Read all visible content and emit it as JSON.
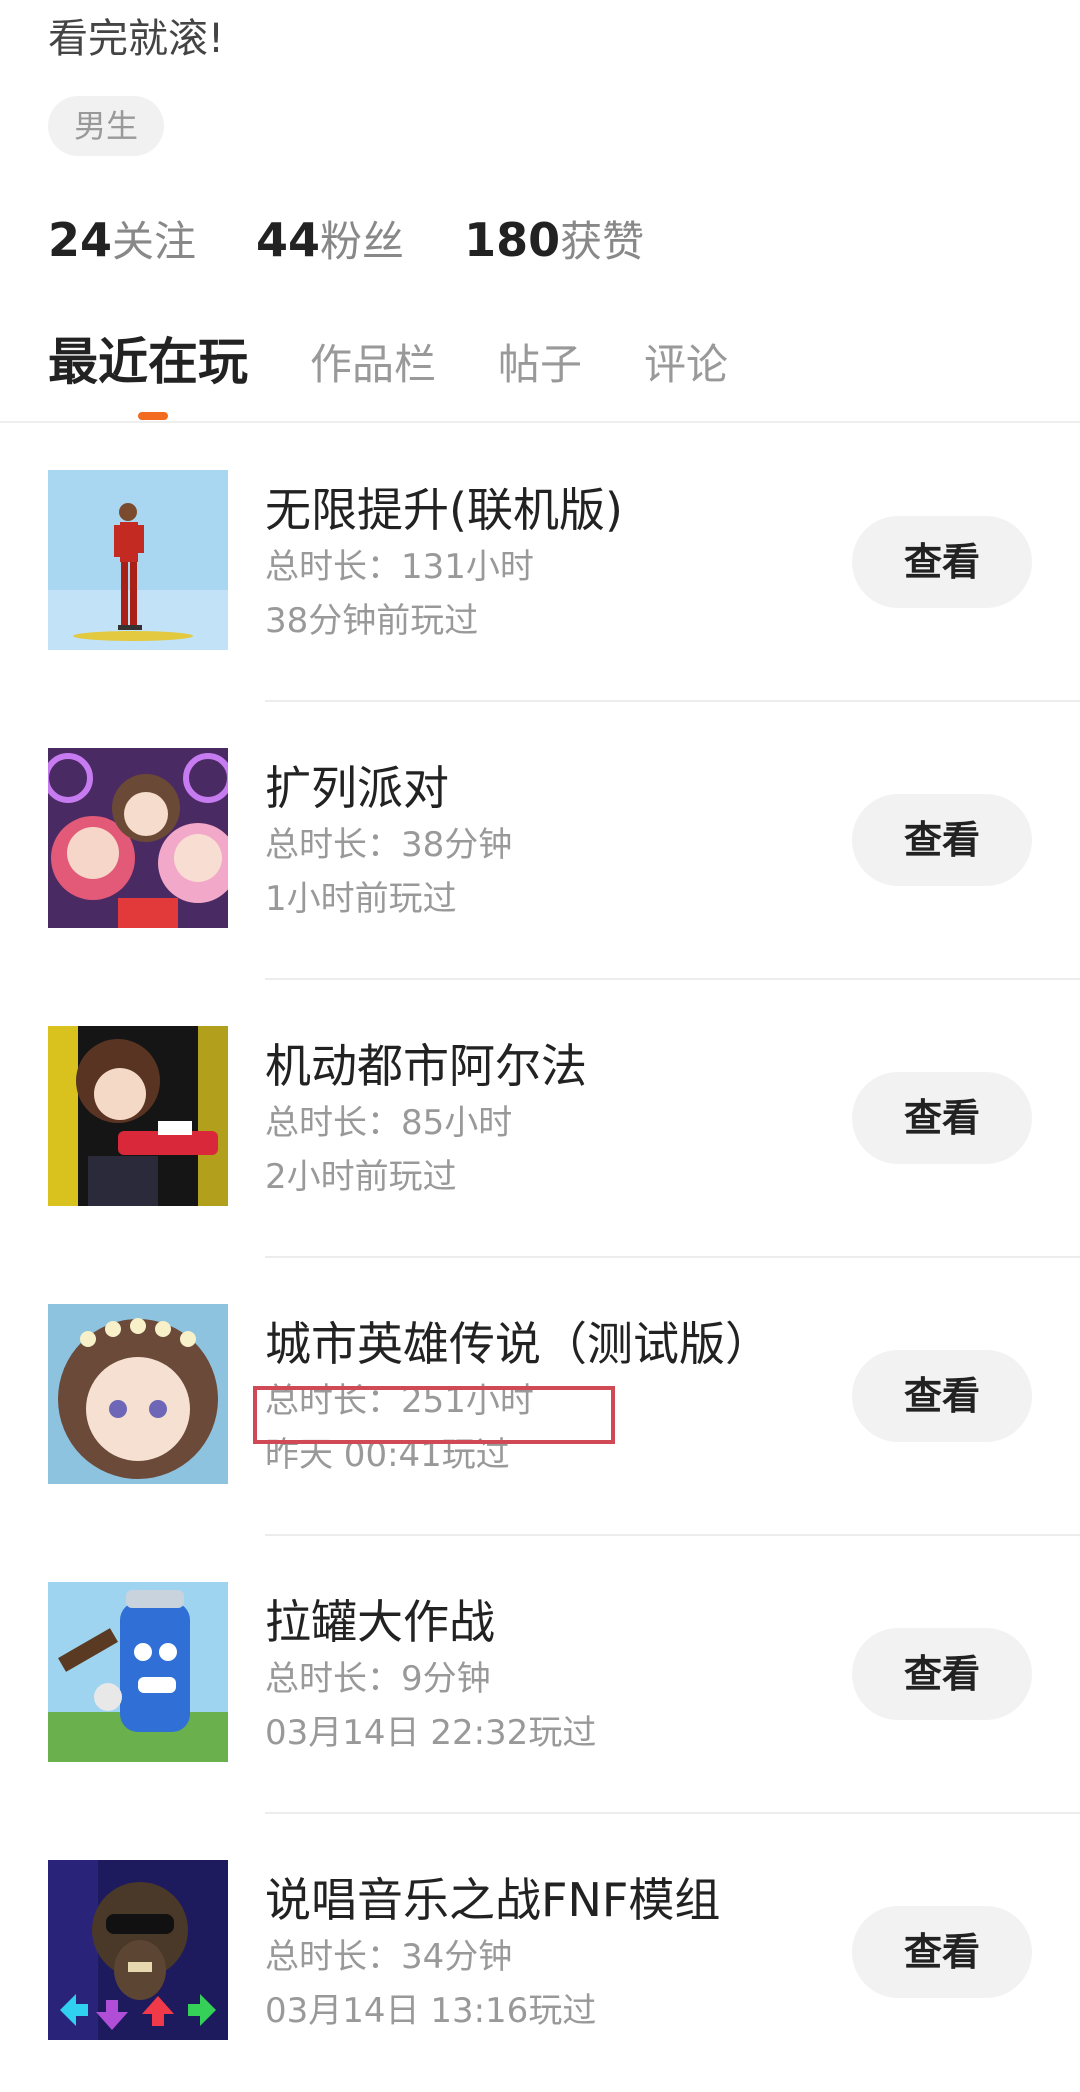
{
  "profile": {
    "bio": "看完就滚!",
    "gender_tag": "男生",
    "stats": [
      {
        "count": "24",
        "label": "关注"
      },
      {
        "count": "44",
        "label": "粉丝"
      },
      {
        "count": "180",
        "label": "获赞"
      }
    ]
  },
  "tabs": [
    "最近在玩",
    "作品栏",
    "帖子",
    "评论"
  ],
  "active_tab": "最近在玩",
  "accent_color": "#f26b21",
  "highlight_color": "#cf4a54",
  "games": [
    {
      "name": "无限提升(联机版)",
      "duration": "总时长：131小时",
      "last_played": "38分钟前玩过",
      "button": "查看"
    },
    {
      "name": "扩列派对",
      "duration": "总时长：38分钟",
      "last_played": "1小时前玩过",
      "button": "查看"
    },
    {
      "name": "机动都市阿尔法",
      "duration": "总时长：85小时",
      "last_played": "2小时前玩过",
      "button": "查看"
    },
    {
      "name": "城市英雄传说（测试版）",
      "duration": "总时长：251小时",
      "last_played": "昨天 00:41玩过",
      "button": "查看"
    },
    {
      "name": "拉罐大作战",
      "duration": "总时长：9分钟",
      "last_played": "03月14日 22:32玩过",
      "button": "查看"
    },
    {
      "name": "说唱音乐之战FNF模组",
      "duration": "总时长：34分钟",
      "last_played": "03月14日 13:16玩过",
      "button": "查看"
    }
  ]
}
